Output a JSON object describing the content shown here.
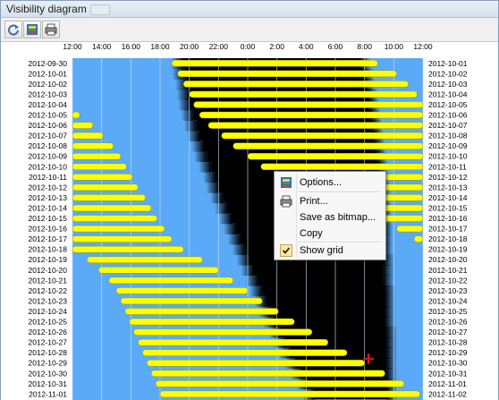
{
  "window": {
    "title": "Visibility diagram"
  },
  "toolbar": {
    "buttons": [
      {
        "name": "refresh",
        "icon": "refresh-icon"
      },
      {
        "name": "options",
        "icon": "options-icon"
      },
      {
        "name": "print",
        "icon": "printer-icon"
      }
    ]
  },
  "chart_data": {
    "type": "bar",
    "title": "",
    "xlabel": "",
    "ylabel": "",
    "x_ticks": [
      "12:00",
      "14:00",
      "16:00",
      "18:00",
      "20:00",
      "22:00",
      "0:00",
      "2:00",
      "4:00",
      "6:00",
      "8:00",
      "10:00",
      "12:00"
    ],
    "x_range_hours": [
      12,
      36
    ],
    "grid": true,
    "colors": {
      "day_sky": "#5aaaf8",
      "night_sky": "#000000",
      "visibility_bar": "#ffff00",
      "bar_outline": "#8a8a00"
    },
    "dates": [
      "2012-09-30",
      "2012-10-01",
      "2012-10-02",
      "2012-10-03",
      "2012-10-04",
      "2012-10-05",
      "2012-10-06",
      "2012-10-07",
      "2012-10-08",
      "2012-10-09",
      "2012-10-10",
      "2012-10-11",
      "2012-10-12",
      "2012-10-13",
      "2012-10-14",
      "2012-10-15",
      "2012-10-16",
      "2012-10-17",
      "2012-10-18",
      "2012-10-19",
      "2012-10-20",
      "2012-10-21",
      "2012-10-22",
      "2012-10-23",
      "2012-10-24",
      "2012-10-25",
      "2012-10-26",
      "2012-10-27",
      "2012-10-28",
      "2012-10-29",
      "2012-10-30",
      "2012-10-31",
      "2012-11-01"
    ],
    "right_dates": [
      "2012-10-01",
      "2012-10-02",
      "2012-10-03",
      "2012-10-04",
      "2012-10-05",
      "2012-10-06",
      "2012-10-07",
      "2012-10-08",
      "2012-10-09",
      "2012-10-10",
      "2012-10-11",
      "2012-10-12",
      "2012-10-13",
      "2012-10-14",
      "2012-10-15",
      "2012-10-16",
      "2012-10-17",
      "2012-10-18",
      "2012-10-19",
      "2012-10-20",
      "2012-10-21",
      "2012-10-22",
      "2012-10-23",
      "2012-10-24",
      "2012-10-25",
      "2012-10-26",
      "2012-10-27",
      "2012-10-28",
      "2012-10-29",
      "2012-10-30",
      "2012-10-31",
      "2012-11-01",
      "2012-11-02"
    ],
    "night_start_hours": [
      19.6,
      19.7,
      19.9,
      20.0,
      20.1,
      20.3,
      20.5,
      20.7,
      21.0,
      21.2,
      21.5,
      21.8,
      22.0,
      22.3,
      22.6,
      22.9,
      23.2,
      23.5,
      23.8,
      24.1,
      24.4,
      24.7,
      25.0,
      25.3,
      25.6,
      25.9,
      26.3,
      26.6,
      27.0,
      27.4,
      27.8,
      28.2,
      28.6
    ],
    "night_end_hours": [
      31.7,
      31.9,
      32.0,
      32.2,
      32.3,
      32.4,
      32.5,
      32.6,
      32.7,
      32.8,
      32.9,
      32.9,
      33.0,
      33.0,
      33.1,
      33.1,
      33.2,
      33.2,
      33.2,
      33.3,
      33.3,
      33.3,
      33.4,
      33.4,
      33.4,
      33.4,
      33.5,
      33.5,
      33.5,
      33.5,
      33.5,
      33.5,
      33.5
    ],
    "visibility_windows": [
      [
        [
          18.8,
          32.9
        ]
      ],
      [
        [
          19.2,
          34.2
        ]
      ],
      [
        [
          19.6,
          35.0
        ]
      ],
      [
        [
          20.0,
          35.6
        ]
      ],
      [
        [
          20.3,
          36.0
        ]
      ],
      [
        [
          12.0,
          12.5
        ],
        [
          20.7,
          36.0
        ]
      ],
      [
        [
          12.0,
          13.4
        ],
        [
          21.3,
          36.0
        ]
      ],
      [
        [
          12.0,
          14.1
        ],
        [
          22.2,
          36.0
        ]
      ],
      [
        [
          12.0,
          14.8
        ],
        [
          23.0,
          36.0
        ]
      ],
      [
        [
          12.0,
          15.3
        ],
        [
          24.0,
          36.0
        ]
      ],
      [
        [
          12.0,
          15.7
        ],
        [
          24.9,
          36.0
        ]
      ],
      [
        [
          12.0,
          16.1
        ],
        [
          26.0,
          36.0
        ]
      ],
      [
        [
          12.0,
          16.5
        ],
        [
          27.2,
          36.0
        ]
      ],
      [
        [
          12.0,
          17.0
        ],
        [
          28.5,
          36.0
        ]
      ],
      [
        [
          12.0,
          17.4
        ],
        [
          30.0,
          36.0
        ]
      ],
      [
        [
          12.0,
          17.8
        ],
        [
          32.0,
          36.0
        ]
      ],
      [
        [
          12.0,
          18.3
        ],
        [
          34.2,
          36.0
        ]
      ],
      [
        [
          12.0,
          18.8
        ],
        [
          35.4,
          36.0
        ]
      ],
      [
        [
          12.0,
          19.6
        ]
      ],
      [
        [
          13.0,
          20.9
        ]
      ],
      [
        [
          13.8,
          22.0
        ]
      ],
      [
        [
          14.5,
          23.0
        ]
      ],
      [
        [
          15.0,
          24.0
        ]
      ],
      [
        [
          15.3,
          25.0
        ]
      ],
      [
        [
          15.6,
          26.1
        ]
      ],
      [
        [
          15.9,
          27.2
        ]
      ],
      [
        [
          16.2,
          28.4
        ]
      ],
      [
        [
          16.5,
          29.5
        ]
      ],
      [
        [
          16.8,
          30.8
        ]
      ],
      [
        [
          17.1,
          32.0
        ]
      ],
      [
        [
          17.4,
          33.4
        ]
      ],
      [
        [
          17.7,
          34.7
        ]
      ],
      [
        [
          18.0,
          35.8
        ]
      ]
    ]
  },
  "context_menu": {
    "items": [
      {
        "label": "Options...",
        "icon": "options-icon",
        "checked": false
      },
      {
        "label": "Print...",
        "icon": "printer-icon",
        "checked": false
      },
      {
        "label": "Save as bitmap...",
        "icon": "",
        "checked": false
      },
      {
        "label": "Copy",
        "icon": "",
        "checked": false
      },
      {
        "label": "Show grid",
        "icon": "checkmark-icon",
        "checked": true
      }
    ]
  },
  "cursor": {
    "icon": "crosshair-cursor-icon",
    "color": "#e01010"
  }
}
